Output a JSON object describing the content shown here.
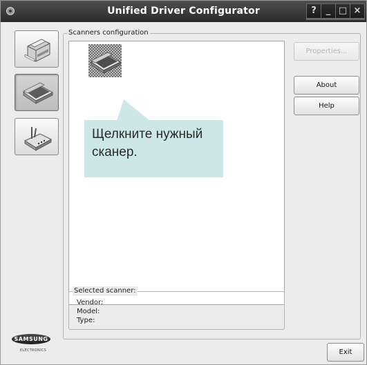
{
  "window": {
    "title": "Unified Driver Configurator",
    "controls": [
      "?",
      "_",
      "□",
      "×"
    ]
  },
  "sidebar": {
    "items": [
      {
        "name": "printers",
        "icon": "printer-icon",
        "active": false
      },
      {
        "name": "scanners",
        "icon": "scanner-icon",
        "active": true
      },
      {
        "name": "ports",
        "icon": "port-icon",
        "active": false
      }
    ]
  },
  "scanners_group": {
    "title": "Scanners configuration",
    "items": [
      {
        "icon": "scanner-icon",
        "selected": false
      }
    ]
  },
  "buttons": {
    "properties": "Properties...",
    "about": "About",
    "help": "Help",
    "exit": "Exit"
  },
  "selected_scanner": {
    "title": "Selected scanner:",
    "vendor_label": "Vendor:",
    "model_label": "Model:",
    "type_label": "Type:"
  },
  "callout": {
    "text": "Щелкните нужный сканер."
  },
  "logo": {
    "brand": "SAMSUNG",
    "sub": "ELECTRONICS"
  }
}
